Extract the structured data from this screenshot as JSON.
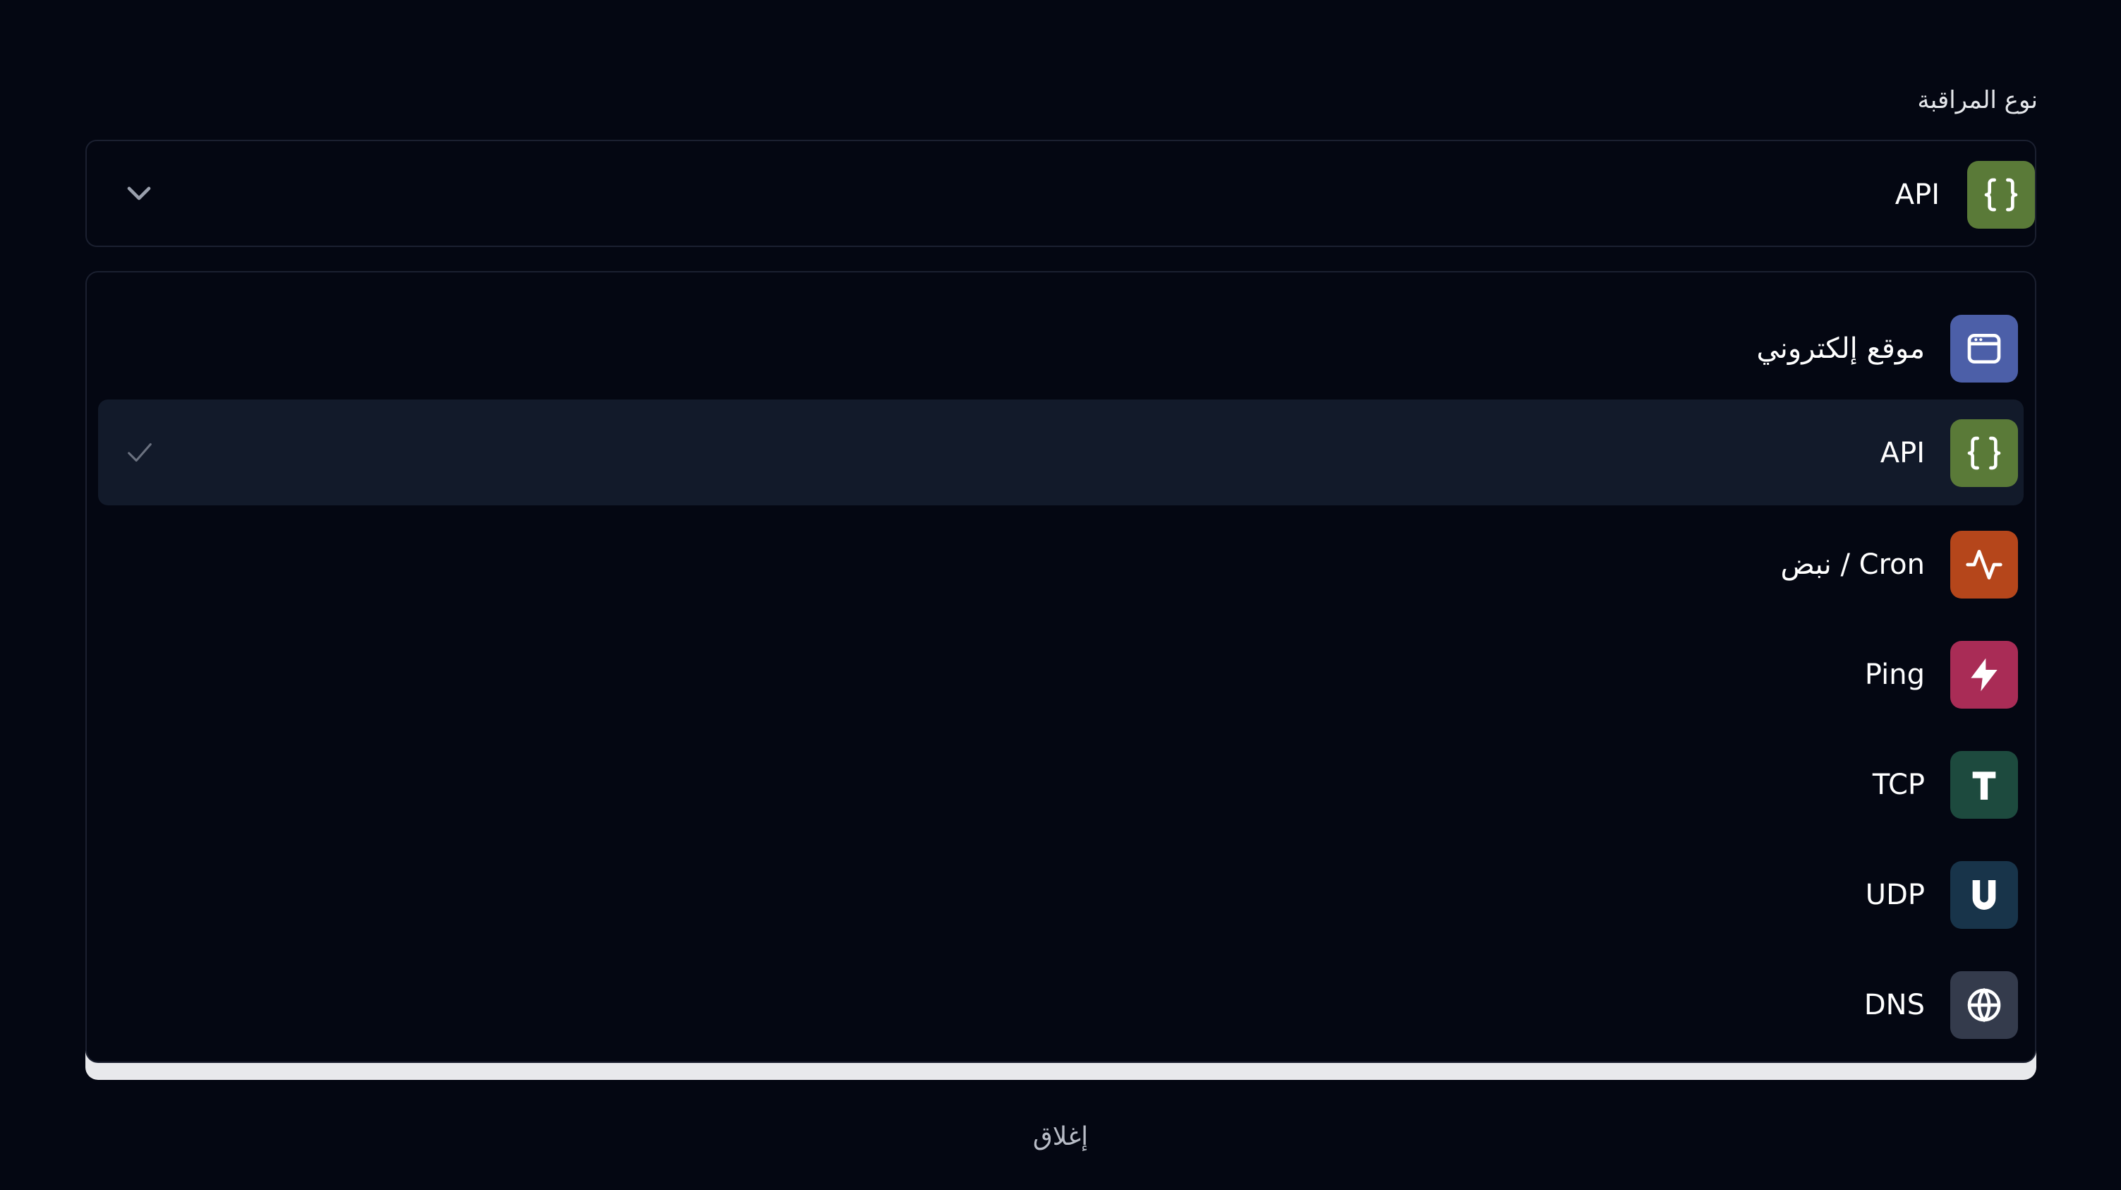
{
  "field": {
    "label": "نوع المراقبة",
    "selected_value": "API"
  },
  "icons": {
    "chevron": "chevron-down-icon",
    "check": "check-icon"
  },
  "options": [
    {
      "label": "موقع إلكتروني",
      "icon": "browser-window-icon",
      "color": "#4c5fa8",
      "selected": false
    },
    {
      "label": "API",
      "icon": "curly-braces-icon",
      "color": "#5a7a38",
      "selected": true
    },
    {
      "label": "نبض / Cron",
      "icon": "heartbeat-icon",
      "color": "#b5461b",
      "selected": false
    },
    {
      "label": "Ping",
      "icon": "lightning-icon",
      "color": "#a92c56",
      "selected": false
    },
    {
      "label": "TCP",
      "icon": "letter-t-icon",
      "color": "#1d4a3e",
      "selected": false
    },
    {
      "label": "UDP",
      "icon": "letter-u-icon",
      "color": "#18344a",
      "selected": false
    },
    {
      "label": "DNS",
      "icon": "globe-icon",
      "color": "#343b4c",
      "selected": false
    }
  ],
  "footer": {
    "close_label": "إغلاق"
  }
}
